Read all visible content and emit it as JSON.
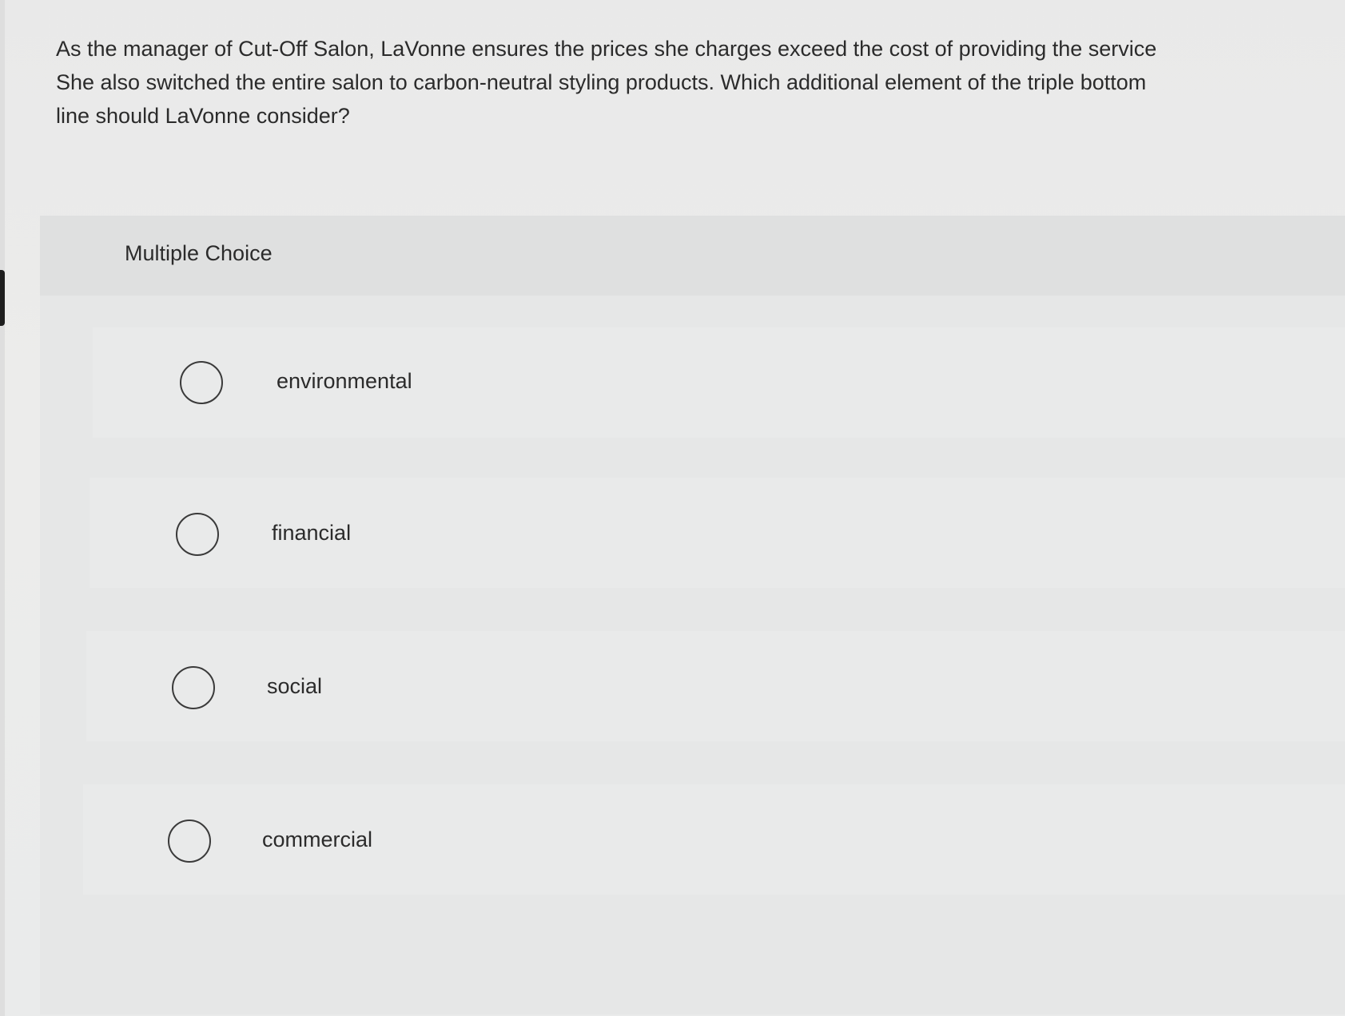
{
  "question": {
    "line1": "As the manager of Cut-Off Salon, LaVonne ensures the prices she charges exceed the cost of providing the service",
    "line2": "She also switched the entire salon to carbon-neutral styling products. Which additional element of the triple bottom",
    "line3": "line should LaVonne consider?"
  },
  "multiple_choice": {
    "title": "Multiple Choice",
    "options": [
      {
        "label": "environmental"
      },
      {
        "label": "financial"
      },
      {
        "label": "social"
      },
      {
        "label": "commercial"
      }
    ]
  },
  "colors": {
    "background": "#ebebeb",
    "panel": "#e3e4e4",
    "option_row": "#e9eaea",
    "text": "#2b2b2b",
    "radio_border": "#3a3a3a"
  },
  "icons": [
    "radio-unselected-icon"
  ]
}
